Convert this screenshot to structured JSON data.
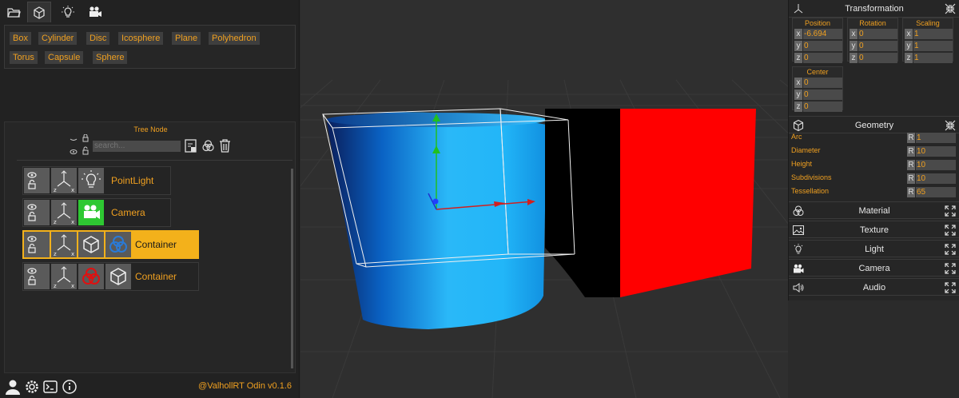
{
  "primitives": [
    "Box",
    "Cylinder",
    "Disc",
    "Icosphere",
    "Plane",
    "Polyhedron",
    "Torus",
    "Capsule",
    "Sphere"
  ],
  "tree": {
    "title": "Tree Node",
    "search_placeholder": "search...",
    "nodes": [
      {
        "label": "PointLight",
        "type": "light-icon",
        "selected": false
      },
      {
        "label": "Camera",
        "type": "camera-icon",
        "selected": false
      },
      {
        "label": "Container",
        "type": "cube-icon",
        "selected": true
      },
      {
        "label": "Container",
        "type": "material-icon",
        "selected": false
      }
    ]
  },
  "footer": {
    "version": "@ValhollRT Odin v0.1.6"
  },
  "transformation": {
    "title": "Transformation",
    "position": {
      "title": "Position",
      "x": "-6.694",
      "y": "0",
      "z": "0"
    },
    "rotation": {
      "title": "Rotation",
      "x": "0",
      "y": "0",
      "z": "0"
    },
    "scaling": {
      "title": "Scaling",
      "x": "1",
      "y": "1",
      "z": "1"
    },
    "center": {
      "title": "Center",
      "x": "0",
      "y": "0",
      "z": "0"
    }
  },
  "geometry": {
    "title": "Geometry",
    "rows": [
      {
        "label": "Arc",
        "key": "R",
        "value": "1"
      },
      {
        "label": "Diameter",
        "key": "R",
        "value": "10"
      },
      {
        "label": "Height",
        "key": "R",
        "value": "10"
      },
      {
        "label": "Subdivisions",
        "key": "R",
        "value": "10"
      },
      {
        "label": "Tessellation",
        "key": "R",
        "value": "65"
      }
    ]
  },
  "sections": [
    "Material",
    "Texture",
    "Light",
    "Camera",
    "Audio"
  ],
  "axis_labels": {
    "x": "x",
    "y": "y",
    "z": "z"
  },
  "colors": {
    "accent": "#f0a020",
    "selected": "#f3b11b",
    "cylinder": "#1aa0e8",
    "cube": "#ff0000"
  }
}
